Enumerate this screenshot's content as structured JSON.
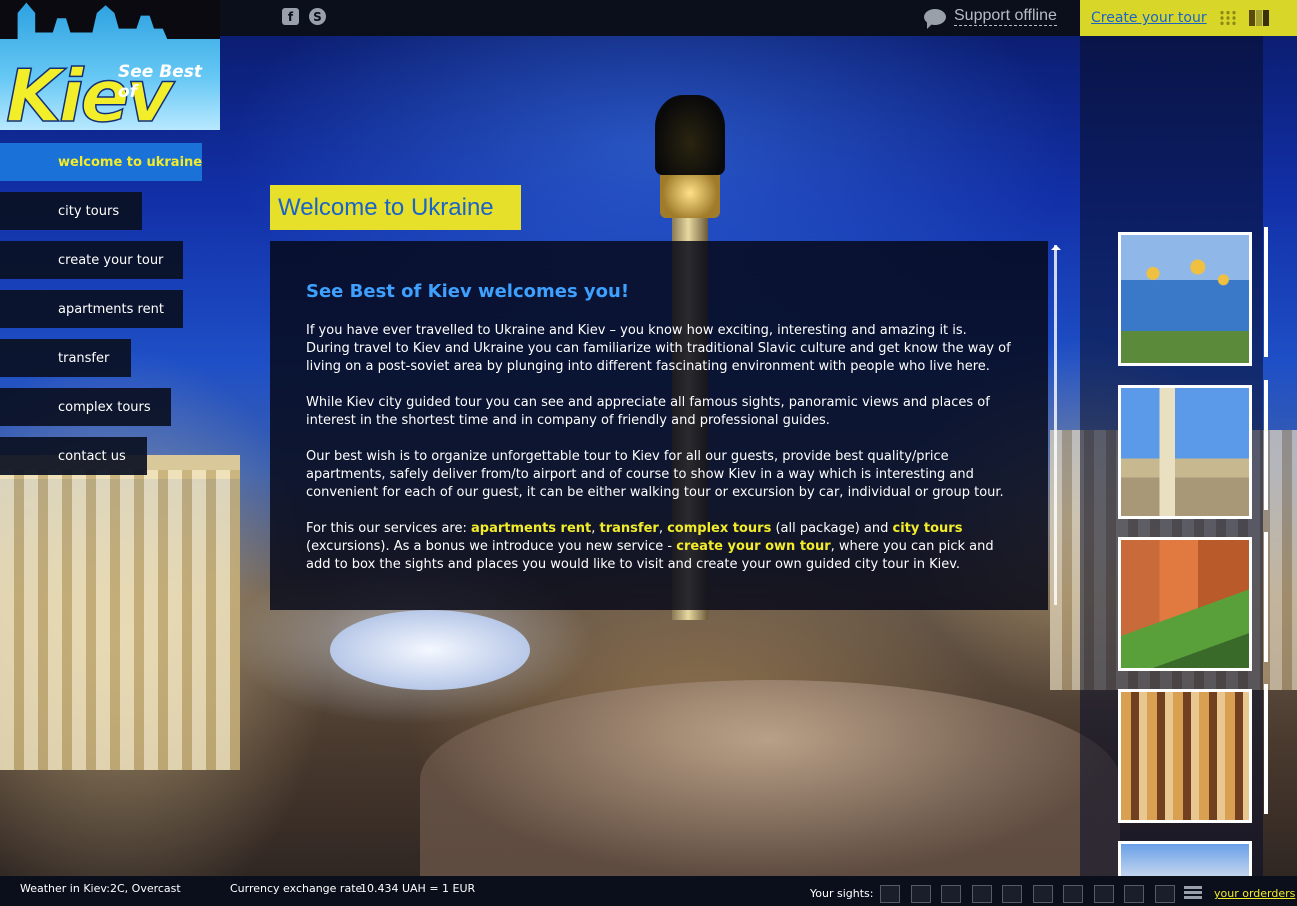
{
  "header": {
    "social": [
      {
        "name": "facebook",
        "glyph": "f"
      },
      {
        "name": "skype",
        "glyph": "S"
      }
    ],
    "support_status": "Support offline",
    "create_tour_link": "Create your tour"
  },
  "logo": {
    "subtitle": "See Best of",
    "title": "Kiev"
  },
  "nav": {
    "items": [
      {
        "label": "welcome to ukraine",
        "active": true
      },
      {
        "label": "city tours"
      },
      {
        "label": "create your tour"
      },
      {
        "label": "apartments rent"
      },
      {
        "label": "transfer"
      },
      {
        "label": "complex tours"
      },
      {
        "label": "contact us"
      }
    ]
  },
  "page": {
    "title": "Welcome to Ukraine",
    "heading": "See Best of Kiev welcomes you!",
    "paragraphs": [
      "If you have ever travelled to Ukraine and Kiev – you know how exciting, interesting and amazing it is. During travel to Kiev and Ukraine you can familiarize with traditional Slavic culture and get know the way of living on a post-soviet area by plunging into different fascinating environment with people who live here.",
      "While Kiev city guided tour you can see and appreciate all famous sights, panoramic views and places of interest in the shortest time and in company of friendly and professional guides.",
      "Our best wish is to organize unforgettable tour to Kiev for all our guests, provide best quality/price apartments, safely deliver from/to airport and of course to show Kiev in a way which is interesting and convenient for each of our guest, it can be either walking tour or excursion by car, individual or group tour."
    ],
    "services": {
      "intro": "For this our services are: ",
      "apartments": "apartments rent",
      "sep1": ", ",
      "transfer": "transfer",
      "sep2": ", ",
      "complex": "complex tours",
      "package": " (all package) and ",
      "city": "city tours",
      "excursions": " (excursions). As a bonus  we introduce you new service - ",
      "create": "create your own tour",
      "outro": ", where you can pick and add to box the sights and places you would like to visit and create your own guided city tour in Kiev."
    }
  },
  "footer": {
    "weather_label": "Weather in Kiev:",
    "weather_value": "2C, Overcast",
    "currency_label": "Currency exchange rate",
    "currency_value": "10.434 UAH = 1 EUR",
    "sights_label": "Your sights:",
    "sight_slot_count": 10,
    "orders_link": "your orderders"
  },
  "colors": {
    "accent_yellow": "#e6e02a",
    "accent_blue": "#1a72d8",
    "heading_blue": "#3ea0ff",
    "bar_dark": "#0b0f1c"
  }
}
